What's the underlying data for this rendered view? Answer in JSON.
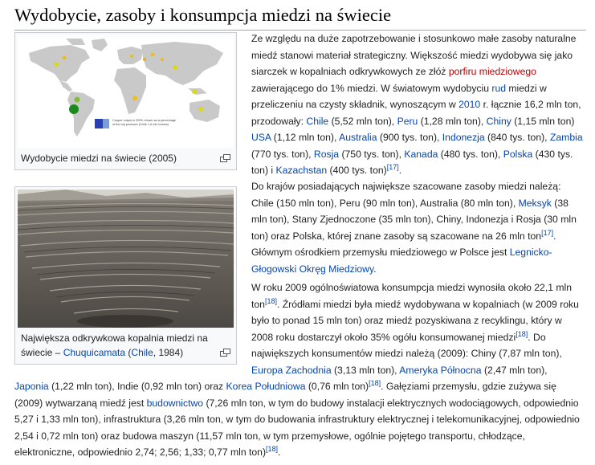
{
  "section": {
    "title": "Wydobycie, zasoby i konsumpcja miedzi na świecie"
  },
  "figures": [
    {
      "caption": "Wydobycie miedzi na świecie (2005)",
      "legend_text": "Copper output in 2005, shown as a percentage of the top producer (Chile 1.6 mln tonnes)"
    },
    {
      "caption_prefix": "Największa odkrywkowa kopalnia miedzi na świecie – ",
      "caption_link1": "Chuquicamata",
      "caption_mid": " (",
      "caption_link2": "Chile",
      "caption_suffix": ", 1984)"
    }
  ],
  "p1": {
    "t1": "Ze względu na duże zapotrzebowanie i stosunkowo małe zasoby naturalne miedź stanowi materiał strategiczny. Większość miedzi wydobywa się jako siarczek w kopalniach odkrywkowych ze złóż ",
    "l1": "porfiru miedziowego",
    "t2": " zawierającego do 1% miedzi. W światowym wydobyciu ",
    "l2": "rud",
    "t3": " miedzi w przeliczeniu na czysty składnik, wynoszącym w ",
    "l3": "2010",
    "t4": " r. łącznie 16,2 mln ton, przodowały: ",
    "l4": "Chile",
    "t5": " (5,52 mln ton), ",
    "l5": "Peru",
    "t6": " (1,28 mln ton), ",
    "l6": "Chiny",
    "t7": " (1,15 mln ton) ",
    "l7": "USA",
    "t8": " (1,12 mln ton), ",
    "l8": "Australia",
    "t9": " (900 tys. ton), ",
    "l9": "Indonezja",
    "t10": " (840 tys. ton), ",
    "l10": "Zambia",
    "t11": " (770 tys. ton), ",
    "l11": "Rosja",
    "t12": " (750 tys. ton), ",
    "l12": "Kanada",
    "t13": " (480 tys. ton), ",
    "l13": "Polska",
    "t14": " (430 tys. ton) i ",
    "l14": "Kazachstan",
    "t15": " (400 tys. ton)",
    "ref": "[17]",
    "t16": "."
  },
  "p2": {
    "t1": "Do krajów posiadających największe szacowane zasoby miedzi należą: Chile (150 mln ton), Peru (90 mln ton), Australia (80 mln ton), ",
    "l1": "Meksyk",
    "t2": " (38 mln ton), Stany Zjednoczone (35 mln ton), Chiny, Indonezja i Rosja (30 mln ton) oraz Polska, której znane zasoby są szacowane na 26 mln ton",
    "ref": "[17]",
    "t3": ". Głównym ośrodkiem przemysłu miedziowego w Polsce jest ",
    "l2": "Legnicko-Głogowski Okręg Miedziowy",
    "t4": "."
  },
  "p3": {
    "t1": "W roku 2009 ogólnoświatowa konsumpcja miedzi wynosiła około 22,1 mln ton",
    "ref1": "[18]",
    "t2": ". Źródłami miedzi była miedź wydobywana w kopalniach (w 2009 roku było to ponad 15 mln ton) oraz miedź pozyskiwana z recyklingu, który w 2008 roku dostarczył około 35% ogółu konsumowanej miedzi",
    "ref2": "[18]",
    "t3": ". Do największych konsumentów miedzi należą (2009): Chiny (7,87 mln ton), ",
    "l1": "Europa Zachodnia",
    "t4": " (3,13 mln ton), ",
    "l2": "Ameryka Północna",
    "t5": " (2,47 mln ton),",
    "l3": "Japonia",
    "t6": " (1,22 mln ton), Indie (0,92 mln ton) oraz ",
    "l4": "Korea Południowa",
    "t7": " (0,76 mln ton)",
    "ref3": "[18]",
    "t8": ". Gałęziami przemysłu, gdzie zużywa się (2009) wytwarzaną miedź jest ",
    "l5": "budownictwo",
    "t9": " (7,26 mln ton, w tym do budowy instalacji elektrycznych wodociągowych, odpowiednio 5,27 i 1,33 mln ton), infrastruktura (3,26 mln ton, w tym do budowania infrastruktury elektrycznej i telekomunikacyjnej, odpowiednio 2,54 i 0,72 mln ton) oraz budowa maszyn (11,57 mln ton, w tym przemysłowe, ogólnie pojętego transportu, chłodzące, elektroniczne, odpowiednio 2,74; 2,56; 1,33; 0,77 mln ton)",
    "ref4": "[18]",
    "t10": "."
  },
  "colors": {
    "link": "#0645ad",
    "redlink": "#ba0000",
    "thumb_bg": "#f8f9fa",
    "border": "#c8ccd1"
  }
}
